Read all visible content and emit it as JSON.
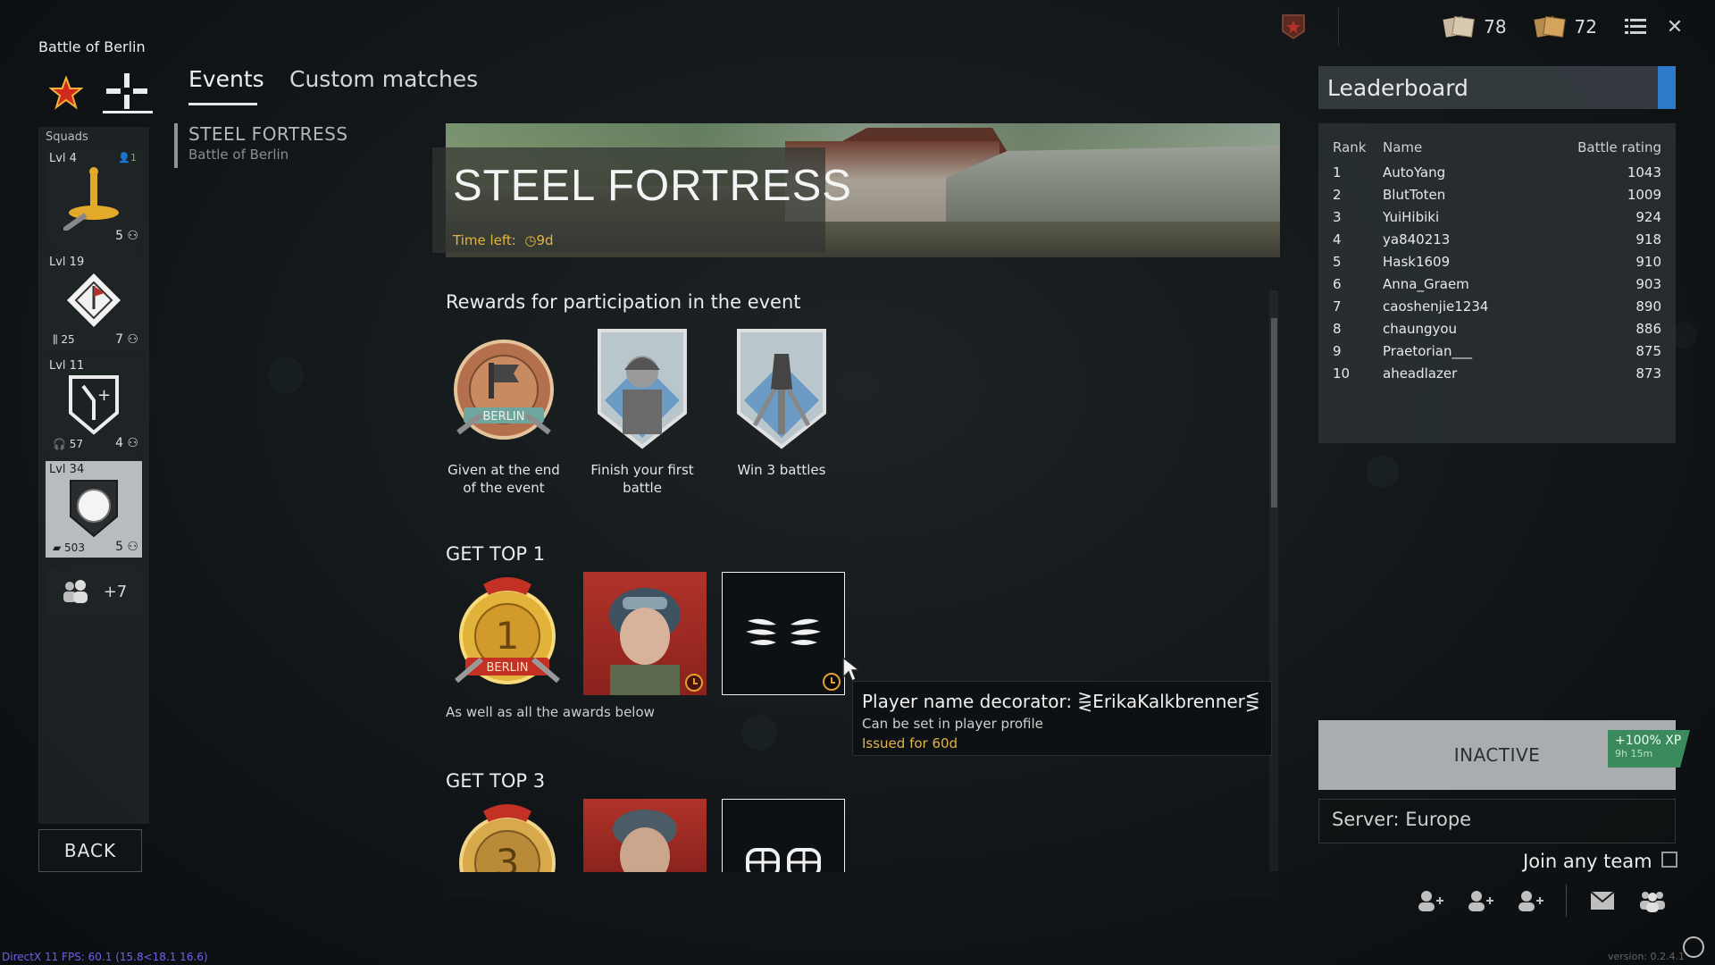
{
  "header": {
    "battle_title": "Battle of Berlin",
    "currencies": [
      {
        "icon": "silver-ticket-icon",
        "value": "78"
      },
      {
        "icon": "gold-ticket-icon",
        "value": "72"
      }
    ]
  },
  "sidebar": {
    "squads_label": "Squads",
    "squads": [
      {
        "level": "Lvl 4",
        "count": "5",
        "extra": "1",
        "emblem": "infantry-emblem"
      },
      {
        "level": "Lvl 19",
        "count": "7",
        "badge": "25",
        "emblem": "mortar-emblem"
      },
      {
        "level": "Lvl 11",
        "count": "4",
        "badge": "57",
        "emblem": "radio-emblem"
      },
      {
        "level": "Lvl 34",
        "count": "5",
        "badge": "503",
        "emblem": "tank-emblem"
      }
    ],
    "more_squads": "+7",
    "back_label": "BACK"
  },
  "tabs": [
    {
      "label": "Events",
      "active": true
    },
    {
      "label": "Custom matches",
      "active": false
    }
  ],
  "event_list": [
    {
      "name": "STEEL FORTRESS",
      "subtitle": "Battle of Berlin"
    }
  ],
  "event": {
    "title": "STEEL FORTRESS",
    "time_left_label": "Time left:",
    "time_left_value": "9d",
    "participation_title": "Rewards for participation in the event",
    "participation_rewards": [
      {
        "caption": "Given at the end of the event",
        "icon": "berlin-medal-icon"
      },
      {
        "caption": "Finish your first battle",
        "icon": "soldier-portrait-icon"
      },
      {
        "caption": "Win 3 battles",
        "icon": "grenade-badge-icon"
      }
    ],
    "top1_title": "GET TOP 1",
    "top1_note": "As well as all the awards below",
    "top3_title": "GET TOP 3"
  },
  "tooltip": {
    "title": "Player name decorator: ⋛ErikaKalkbrenner⋚",
    "subtitle": "Can be set in player profile",
    "issued": "Issued for 60d"
  },
  "leaderboard": {
    "title": "Leaderboard",
    "columns": [
      "Rank",
      "Name",
      "Battle rating"
    ],
    "rows": [
      {
        "rank": "1",
        "name": "AutoYang",
        "rating": "1043"
      },
      {
        "rank": "2",
        "name": "BlutToten",
        "rating": "1009"
      },
      {
        "rank": "3",
        "name": "YuiHibiki",
        "rating": "924"
      },
      {
        "rank": "4",
        "name": "ya840213",
        "rating": "918"
      },
      {
        "rank": "5",
        "name": "Hask1609",
        "rating": "910"
      },
      {
        "rank": "6",
        "name": "Anna_Graem",
        "rating": "903"
      },
      {
        "rank": "7",
        "name": "caoshenjie1234",
        "rating": "890"
      },
      {
        "rank": "8",
        "name": "chaungyou",
        "rating": "886"
      },
      {
        "rank": "9",
        "name": "Praetorian___",
        "rating": "875"
      },
      {
        "rank": "10",
        "name": "aheadlazer",
        "rating": "873"
      }
    ]
  },
  "matchmaking": {
    "status_label": "INACTIVE",
    "xp_bonus": "+100% XP",
    "xp_time": "9h 15m",
    "server_label": "Server: Europe",
    "join_any_team": "Join any team"
  },
  "footer": {
    "fps": "DirectX 11 FPS: 60.1 (15.8<18.1 16.6)",
    "version": "version: 0.2.4.1"
  },
  "colors": {
    "accent_blue": "#2f79c9",
    "timer_gold": "#e0b542",
    "xp_green": "#3b8a5d"
  }
}
